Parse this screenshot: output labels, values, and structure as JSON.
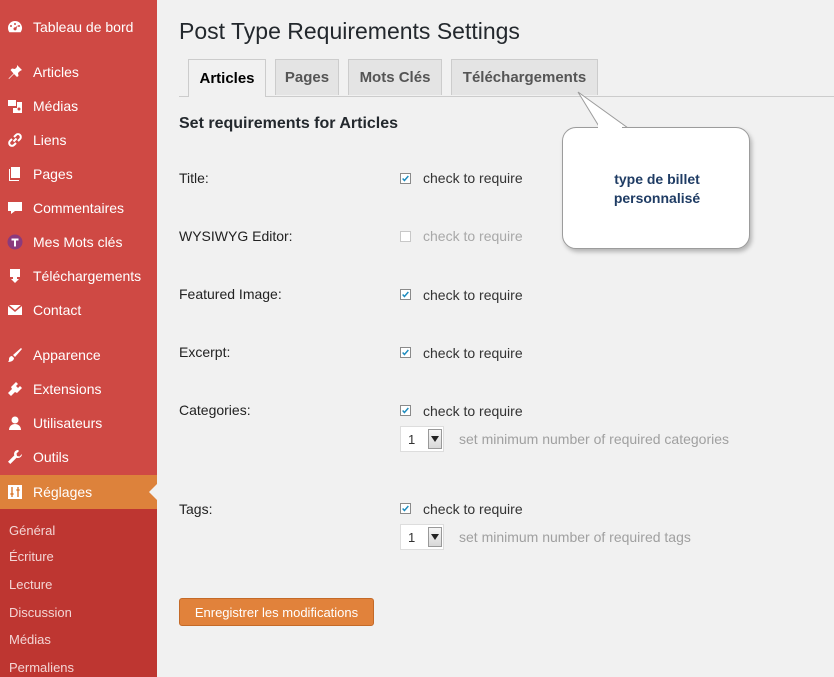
{
  "sidebar": {
    "items": [
      {
        "label": "Tableau de bord",
        "icon": "dashboard-icon"
      },
      {
        "label": "Articles",
        "icon": "pin-icon"
      },
      {
        "label": "Médias",
        "icon": "media-icon"
      },
      {
        "label": "Liens",
        "icon": "link-icon"
      },
      {
        "label": "Pages",
        "icon": "pages-icon"
      },
      {
        "label": "Commentaires",
        "icon": "comment-icon"
      },
      {
        "label": "Mes Mots clés",
        "icon": "tag-icon"
      },
      {
        "label": "Téléchargements",
        "icon": "download-icon"
      },
      {
        "label": "Contact",
        "icon": "envelope-icon"
      },
      {
        "label": "Apparence",
        "icon": "brush-icon"
      },
      {
        "label": "Extensions",
        "icon": "plugin-icon"
      },
      {
        "label": "Utilisateurs",
        "icon": "user-icon"
      },
      {
        "label": "Outils",
        "icon": "wrench-icon"
      },
      {
        "label": "Réglages",
        "icon": "settings-icon"
      }
    ],
    "submenu": [
      "Général",
      "Écriture",
      "Lecture",
      "Discussion",
      "Médias",
      "Permaliens"
    ],
    "colors": {
      "background": "#cf4944",
      "active": "#dd823b",
      "submenu": "#be3631"
    }
  },
  "page": {
    "title": "Post Type Requirements Settings",
    "tabs": [
      "Articles",
      "Pages",
      "Mots Clés",
      "Téléchargements"
    ],
    "active_tab": "Articles",
    "section_heading": "Set requirements for Articles"
  },
  "fields": {
    "title": {
      "label": "Title:",
      "check_label": "check to require",
      "checked": true
    },
    "wysiwyg": {
      "label": "WYSIWYG Editor:",
      "check_label": "check to require",
      "checked": false,
      "disabled": true
    },
    "featured_image": {
      "label": "Featured Image:",
      "check_label": "check to require",
      "checked": true
    },
    "excerpt": {
      "label": "Excerpt:",
      "check_label": "check to require",
      "checked": true
    },
    "categories": {
      "label": "Categories:",
      "check_label": "check to require",
      "checked": true,
      "min_value": "1",
      "min_hint": "set minimum number of required categories"
    },
    "tags": {
      "label": "Tags:",
      "check_label": "check to require",
      "checked": true,
      "min_value": "1",
      "min_hint": "set minimum number of required tags"
    }
  },
  "save_button": "Enregistrer les modifications",
  "callout": {
    "line1": "type de billet",
    "line2": "personnalisé"
  },
  "accent_color": "#e1823b"
}
